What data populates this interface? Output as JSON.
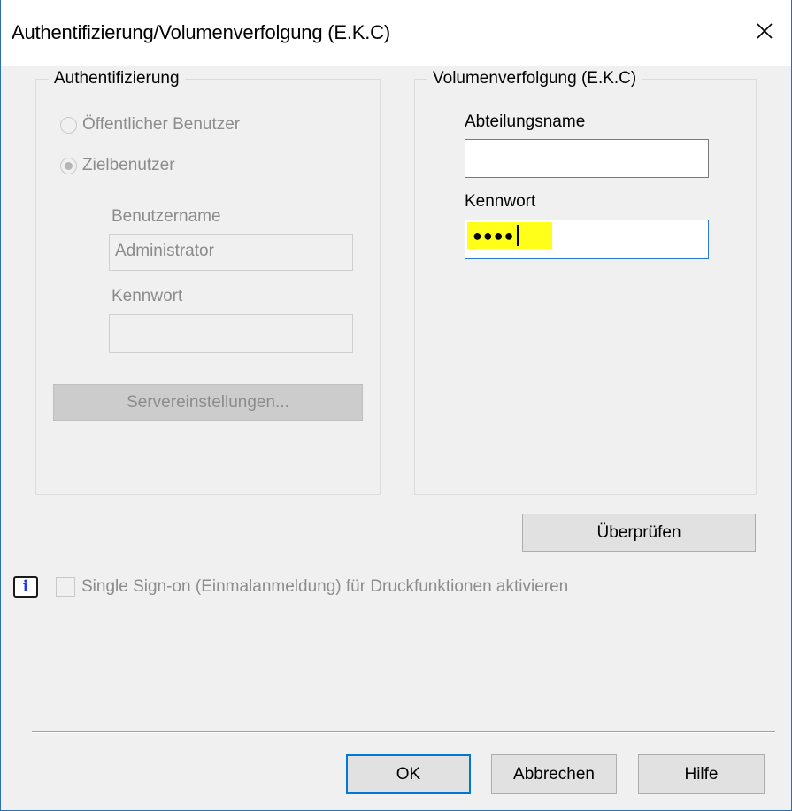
{
  "window": {
    "title": "Authentifizierung/Volumenverfolgung (E.K.C)"
  },
  "auth_group": {
    "legend": "Authentifizierung",
    "radio_public": {
      "label": "Öffentlicher Benutzer",
      "selected": false,
      "enabled": false
    },
    "radio_target": {
      "label": "Zielbenutzer",
      "selected": true,
      "enabled": false
    },
    "username_label": "Benutzername",
    "username_value": "Administrator",
    "password_label": "Kennwort",
    "password_value": "",
    "server_settings_button": "Servereinstellungen..."
  },
  "tracking_group": {
    "legend": "Volumenverfolgung (E.K.C)",
    "department_label": "Abteilungsname",
    "department_value": "",
    "password_label": "Kennwort",
    "password_masked": "●●●●"
  },
  "verify_button": "Überprüfen",
  "sso": {
    "info_icon_glyph": "i",
    "label": "Single Sign-on (Einmalanmeldung) für Druckfunktionen aktivieren",
    "checked": false,
    "enabled": false
  },
  "footer": {
    "ok": "OK",
    "cancel": "Abbrechen",
    "help": "Hilfe"
  },
  "colors": {
    "highlight": "#ffff1a",
    "focus_border": "#2a7bd5",
    "default_button_border": "#0078d7",
    "info_icon": "#1a37ff"
  }
}
